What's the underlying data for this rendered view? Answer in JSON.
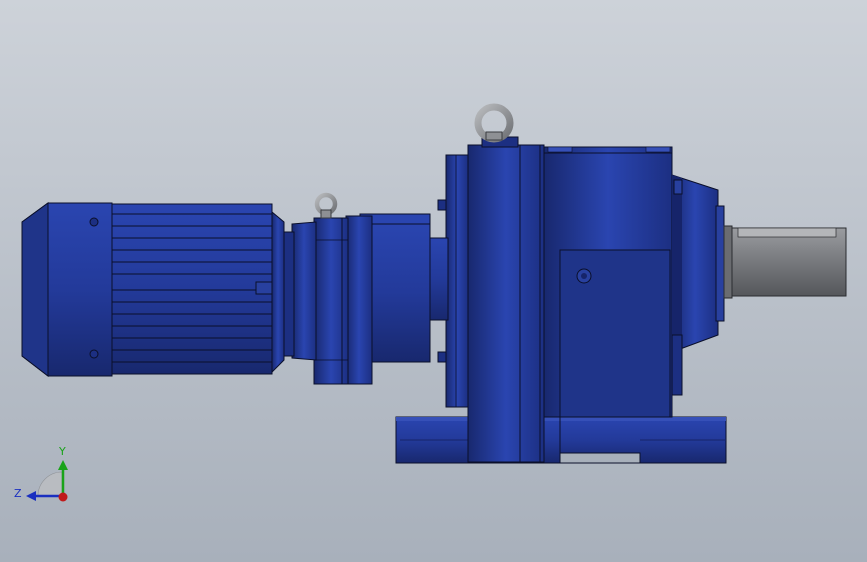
{
  "viewport": {
    "background_top": "#cdd2d9",
    "background_bottom": "#a8b0bb"
  },
  "colors": {
    "body_blue": "#233a9a",
    "body_blue_dark": "#16246a",
    "body_blue_light": "#3a55c0",
    "steel_gray": "#7d7f82",
    "steel_light": "#a9abae",
    "outline": "#0a0f2a"
  },
  "triad": {
    "y_label": "Y",
    "z_label": "Z",
    "y_color": "#1aa31a",
    "z_color": "#1a2fc0",
    "x_color": "#c01a1a"
  },
  "parts": [
    {
      "id": "motor",
      "icon": "electric-motor"
    },
    {
      "id": "planetary-stage",
      "icon": "gear-stage"
    },
    {
      "id": "gearbox-housing",
      "icon": "gear-housing"
    },
    {
      "id": "output-shaft",
      "icon": "shaft"
    },
    {
      "id": "lifting-eye-large",
      "icon": "eye-bolt"
    },
    {
      "id": "lifting-eye-small",
      "icon": "eye-bolt"
    },
    {
      "id": "foot-mount",
      "icon": "base-plate"
    }
  ]
}
